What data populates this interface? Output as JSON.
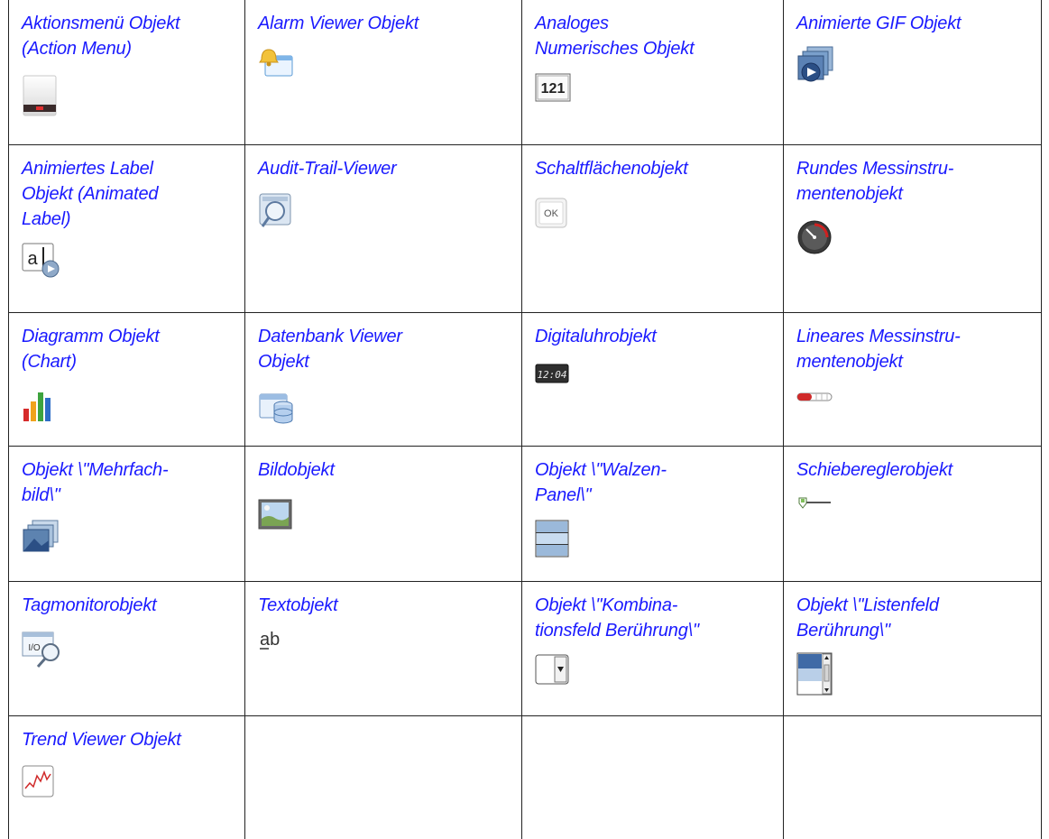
{
  "cells": [
    [
      "Aktionsmenü Objekt\n(Action Menu)",
      "Alarm Viewer Objekt",
      "Analoges\nNumerisches Objekt",
      "Animierte GIF Objekt"
    ],
    [
      "Animiertes Label\nObjekt (Animated\nLabel)",
      "Audit-Trail-Viewer",
      "Schaltflächenobjekt",
      "Rundes Messinstru-\nmentenobjekt"
    ],
    [
      "Diagramm Objekt\n(Chart)",
      "Datenbank Viewer\nObjekt",
      "Digitaluhrobjekt",
      "Lineares Messinstru-\nmentenobjekt"
    ],
    [
      "Objekt \\\"Mehrfach-\nbild\\\"",
      "Bildobjekt",
      "Objekt \\\"Walzen-\nPanel\\\"",
      "Schiebereglerobjekt"
    ],
    [
      "Tagmonitorobjekt",
      "Textobjekt",
      "Objekt \\\"Kombina-\ntionsfeld Berührung\\\"",
      "Objekt \\\"Listenfeld\nBerührung\\\""
    ],
    [
      "Trend Viewer Objekt",
      "",
      "",
      ""
    ]
  ],
  "icon_text": {
    "analog_numeric": "121",
    "button": "OK",
    "digital_clock": "12:04",
    "text_ab": "ab",
    "animated_label": "a",
    "tag_monitor": "I/O"
  },
  "colors": {
    "link": "#1a1aff",
    "border": "#222222"
  }
}
